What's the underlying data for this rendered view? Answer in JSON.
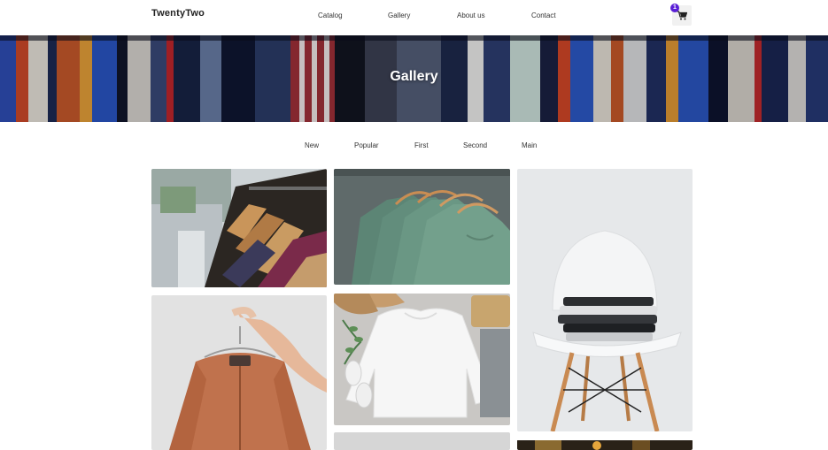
{
  "header": {
    "brand": "TwentyTwo",
    "nav": [
      "Catalog",
      "Gallery",
      "About us",
      "Contact"
    ],
    "cart_count": "1",
    "accent_color": "#5a1fd6"
  },
  "hero": {
    "title": "Gallery"
  },
  "filters": [
    "New",
    "Popular",
    "First",
    "Second",
    "Main"
  ],
  "gallery": {
    "images": [
      {
        "name": "clothing-rack-store-photo",
        "icon": "image"
      },
      {
        "name": "green-tshirts-on-hangers-photo",
        "icon": "image"
      },
      {
        "name": "white-chair-folded-clothes-photo",
        "icon": "image"
      },
      {
        "name": "orange-jacket-on-hanger-photo",
        "icon": "image"
      },
      {
        "name": "white-sweatshirt-flatlay-photo",
        "icon": "image"
      }
    ]
  }
}
